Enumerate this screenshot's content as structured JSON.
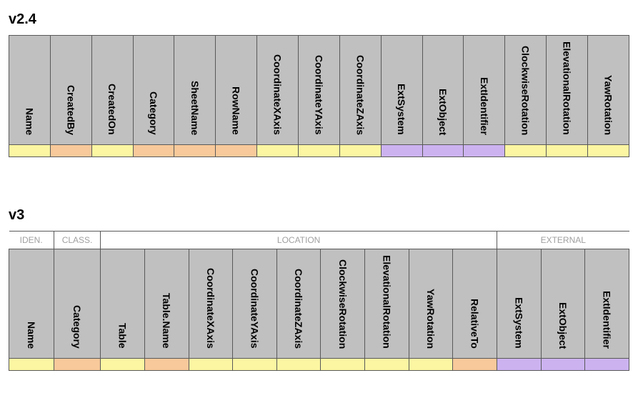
{
  "v24": {
    "title": "v2.4",
    "columns": [
      {
        "label": "Name",
        "color": "c-yellow"
      },
      {
        "label": "CreatedBy",
        "color": "c-orange"
      },
      {
        "label": "CreatedOn",
        "color": "c-yellow"
      },
      {
        "label": "Category",
        "color": "c-orange"
      },
      {
        "label": "SheetName",
        "color": "c-orange"
      },
      {
        "label": "RowName",
        "color": "c-orange"
      },
      {
        "label": "CoordinateXAxis",
        "color": "c-yellow"
      },
      {
        "label": "CoordinateYAxis",
        "color": "c-yellow"
      },
      {
        "label": "CoordinateZAxis",
        "color": "c-yellow"
      },
      {
        "label": "ExtSystem",
        "color": "c-purple"
      },
      {
        "label": "ExtObject",
        "color": "c-purple"
      },
      {
        "label": "ExtIdentifier",
        "color": "c-purple"
      },
      {
        "label": "ClockwiseRotation",
        "color": "c-yellow"
      },
      {
        "label": "ElevationalRotation",
        "color": "c-yellow"
      },
      {
        "label": "YawRotation",
        "color": "c-yellow"
      }
    ]
  },
  "v3": {
    "title": "v3",
    "groups": [
      {
        "label": "IDEN.",
        "span": 1
      },
      {
        "label": "CLASS.",
        "span": 1
      },
      {
        "label": "LOCATION",
        "span": 9
      },
      {
        "label": "EXTERNAL",
        "span": 3
      }
    ],
    "columns": [
      {
        "label": "Name",
        "color": "c-yellow"
      },
      {
        "label": "Category",
        "color": "c-orange"
      },
      {
        "label": "Table",
        "color": "c-yellow"
      },
      {
        "label": "Table.Name",
        "color": "c-orange"
      },
      {
        "label": "CoordinateXAxis",
        "color": "c-yellow"
      },
      {
        "label": "CoordinateYAxis",
        "color": "c-yellow"
      },
      {
        "label": "CoordinateZAxis",
        "color": "c-yellow"
      },
      {
        "label": "ClockwiseRotation",
        "color": "c-yellow"
      },
      {
        "label": "ElevationalRotation",
        "color": "c-yellow"
      },
      {
        "label": "YawRotation",
        "color": "c-yellow"
      },
      {
        "label": "RelativeTo",
        "color": "c-orange"
      },
      {
        "label": "ExtSystem",
        "color": "c-purple"
      },
      {
        "label": "ExtObject",
        "color": "c-purple"
      },
      {
        "label": "ExtIdentifier",
        "color": "c-purple"
      }
    ]
  },
  "layout": {
    "v24_col_width": 58,
    "v3_col_width": 58
  }
}
